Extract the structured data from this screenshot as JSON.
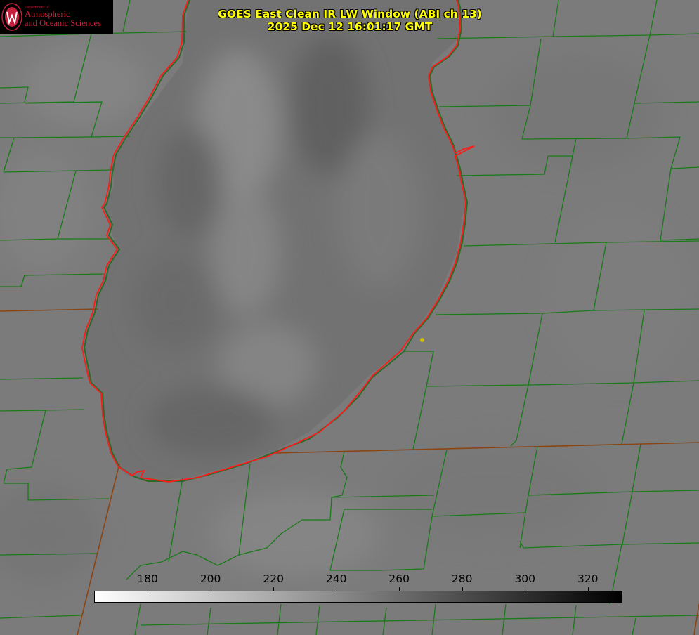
{
  "title": {
    "line1": "GOES East Clean IR LW Window (ABI ch 13)",
    "line2": "2025 Dec 12 16:01:17 GMT"
  },
  "logo": {
    "line_small": "Department of",
    "line1": "Atmospheric",
    "line2": "and Oceanic Sciences",
    "color": "#c5203e"
  },
  "colorbar": {
    "ticks": [
      "180",
      "200",
      "220",
      "240",
      "260",
      "280",
      "300",
      "320"
    ],
    "tick_values": [
      180,
      200,
      220,
      240,
      260,
      280,
      300,
      320
    ],
    "range": [
      163,
      331
    ],
    "gradient": [
      "#ffffff",
      "#000000"
    ]
  },
  "colors": {
    "boundaries": "#1a7a1a",
    "lake_outline": "#ff1a1a",
    "state_line": "#8b4513",
    "marker": "#d4c200"
  }
}
